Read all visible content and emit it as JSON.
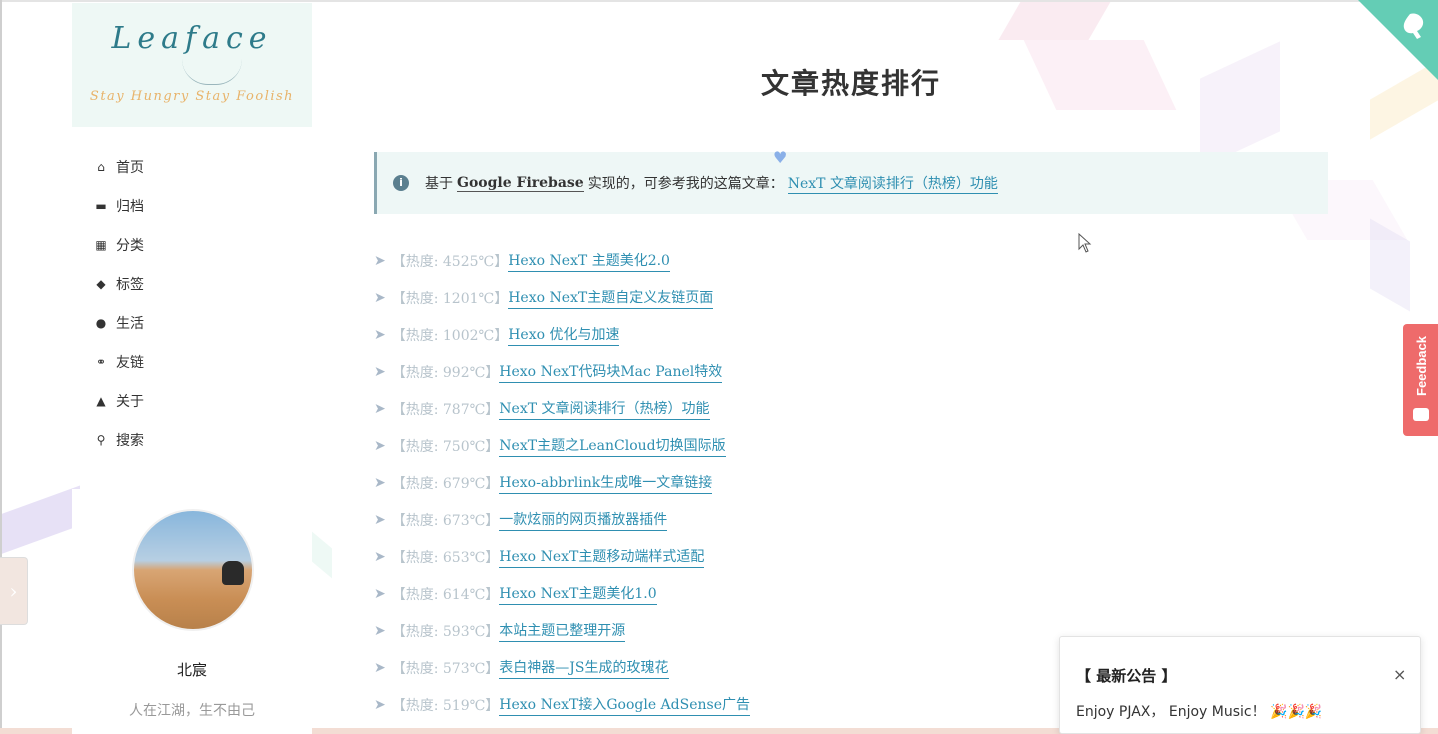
{
  "brand": {
    "title": "Leaface",
    "subtitle": "Stay Hungry Stay Foolish"
  },
  "menu": [
    {
      "label": "首页",
      "icon": "home-icon",
      "glyph": "⌂"
    },
    {
      "label": "归档",
      "icon": "archive-icon",
      "glyph": "▬"
    },
    {
      "label": "分类",
      "icon": "grid-icon",
      "glyph": "▦"
    },
    {
      "label": "标签",
      "icon": "tags-icon",
      "glyph": "◆"
    },
    {
      "label": "生活",
      "icon": "apple-icon",
      "glyph": "●"
    },
    {
      "label": "友链",
      "icon": "link-icon",
      "glyph": "⚭"
    },
    {
      "label": "关于",
      "icon": "user-icon",
      "glyph": "▲"
    },
    {
      "label": "搜索",
      "icon": "search-icon",
      "glyph": "⚲"
    }
  ],
  "profile": {
    "name": "北宸",
    "motto": "人在江湖，生不由己"
  },
  "main": {
    "title": "文章热度排行",
    "note": {
      "prefix": "基于",
      "strong": "Google Firebase",
      "middle": "实现的，可参考我的这篇文章：",
      "link": "NexT 文章阅读排行（热榜）功能"
    },
    "items": [
      {
        "heat": "【热度: 4525℃】",
        "title": "Hexo NexT 主题美化2.0"
      },
      {
        "heat": "【热度: 1201℃】",
        "title": "Hexo NexT主题自定义友链页面"
      },
      {
        "heat": "【热度: 1002℃】",
        "title": "Hexo 优化与加速"
      },
      {
        "heat": "【热度: 992℃】",
        "title": "Hexo NexT代码块Mac Panel特效"
      },
      {
        "heat": "【热度: 787℃】",
        "title": "NexT 文章阅读排行（热榜）功能"
      },
      {
        "heat": "【热度: 750℃】",
        "title": "NexT主题之LeanCloud切换国际版"
      },
      {
        "heat": "【热度: 679℃】",
        "title": "Hexo-abbrlink生成唯一文章链接"
      },
      {
        "heat": "【热度: 673℃】",
        "title": "一款炫丽的网页播放器插件"
      },
      {
        "heat": "【热度: 653℃】",
        "title": "Hexo NexT主题移动端样式适配"
      },
      {
        "heat": "【热度: 614℃】",
        "title": "Hexo NexT主题美化1.0"
      },
      {
        "heat": "【热度: 593℃】",
        "title": "本站主题已整理开源"
      },
      {
        "heat": "【热度: 573℃】",
        "title": "表白神器—JS生成的玫瑰花"
      },
      {
        "heat": "【热度: 519℃】",
        "title": "Hexo NexT接入Google AdSense广告"
      }
    ]
  },
  "feedback": {
    "label": "Feedback"
  },
  "notice": {
    "title": "【 最新公告 】",
    "close": "×",
    "body": "Enjoy PJAX， Enjoy Music！",
    "emoji": "🎉🎉🎉"
  },
  "colors": {
    "accent": "#2f8fb1",
    "brand_bg": "#eef8f5",
    "note_bg": "#eef7f6",
    "feedback": "#ee6b6b",
    "github_corner": "#64cdb5"
  }
}
